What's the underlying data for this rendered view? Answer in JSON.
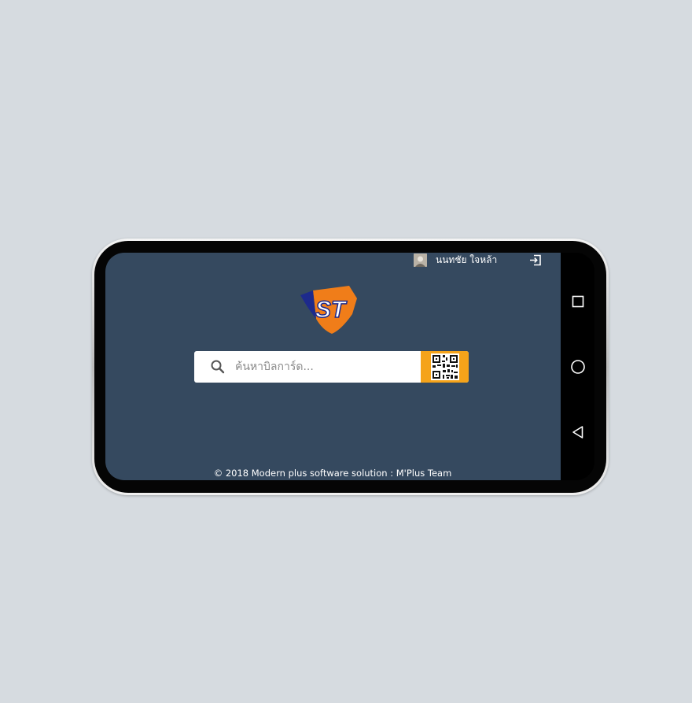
{
  "header": {
    "user_name": "นนทชัย ใจหล้า",
    "avatar_icon": "user-avatar",
    "logout_icon": "logout-icon"
  },
  "logo": {
    "brand_text": "ST",
    "colors": {
      "orange": "#f07d19",
      "navy": "#1d2a8c"
    }
  },
  "search": {
    "placeholder": "ค้นหาบิลการ์ด...",
    "value": "",
    "search_icon": "search-icon",
    "qr_icon": "qr-code-icon",
    "qr_button_color": "#f5a31a"
  },
  "footer": {
    "copyright": "© 2018 Modern plus software solution : M'Plus Team"
  },
  "nav_bar": {
    "recents_icon": "square-icon",
    "home_icon": "circle-icon",
    "back_icon": "triangle-back-icon"
  },
  "colors": {
    "app_background": "#35495f",
    "page_background": "#d6dbe0"
  }
}
